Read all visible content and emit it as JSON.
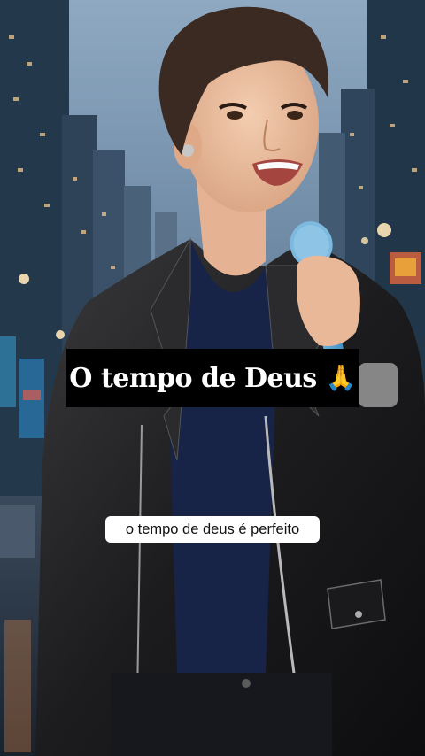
{
  "title_overlay": {
    "text": "O tempo de Deus",
    "emoji": "🙏"
  },
  "caption": {
    "text": "o tempo de deus é perfeito"
  },
  "colors": {
    "title_bg": "#000000",
    "title_fg": "#ffffff",
    "caption_bg": "#ffffff",
    "caption_fg": "#111111"
  }
}
